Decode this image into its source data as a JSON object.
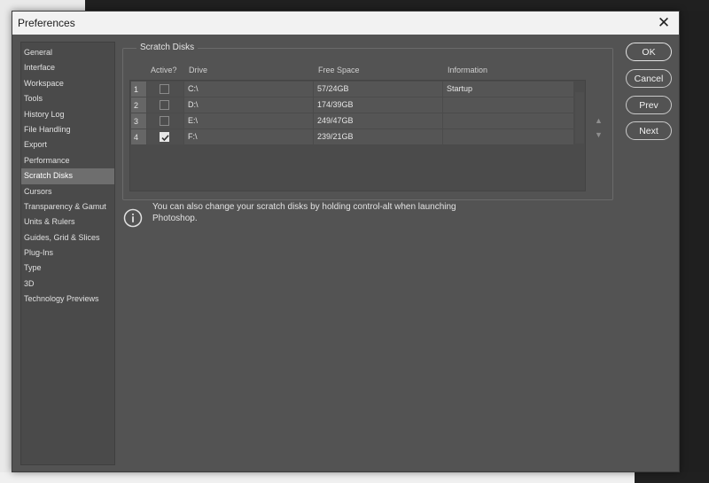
{
  "window": {
    "title": "Preferences",
    "close_glyph": "✕"
  },
  "sidebar": {
    "items": [
      {
        "label": "General"
      },
      {
        "label": "Interface"
      },
      {
        "label": "Workspace"
      },
      {
        "label": "Tools"
      },
      {
        "label": "History Log"
      },
      {
        "label": "File Handling"
      },
      {
        "label": "Export"
      },
      {
        "label": "Performance"
      },
      {
        "label": "Scratch Disks",
        "selected": true
      },
      {
        "label": "Cursors"
      },
      {
        "label": "Transparency & Gamut"
      },
      {
        "label": "Units & Rulers"
      },
      {
        "label": "Guides, Grid & Slices"
      },
      {
        "label": "Plug-Ins"
      },
      {
        "label": "Type"
      },
      {
        "label": "3D"
      },
      {
        "label": "Technology Previews"
      }
    ]
  },
  "scratch": {
    "group_label": "Scratch Disks",
    "columns": {
      "active": "Active?",
      "drive": "Drive",
      "free": "Free Space",
      "info": "Information"
    },
    "rows": [
      {
        "num": "1",
        "active": false,
        "drive": "C:\\",
        "free": "57/24GB",
        "info": "Startup"
      },
      {
        "num": "2",
        "active": false,
        "drive": "D:\\",
        "free": "174/39GB",
        "info": ""
      },
      {
        "num": "3",
        "active": false,
        "drive": "E:\\",
        "free": "249/47GB",
        "info": ""
      },
      {
        "num": "4",
        "active": true,
        "drive": "F:\\",
        "free": "239/21GB",
        "info": ""
      }
    ],
    "move_up_glyph": "▲",
    "move_down_glyph": "▼"
  },
  "buttons": {
    "ok": "OK",
    "cancel": "Cancel",
    "prev": "Prev",
    "next": "Next"
  },
  "note": {
    "text": "You can also change your scratch disks by holding control-alt when launching Photoshop.",
    "icon": "info-icon"
  },
  "colors": {
    "panel": "#535353",
    "selected_item": "#6e6e6e",
    "titlebar": "#f2f2f2"
  }
}
